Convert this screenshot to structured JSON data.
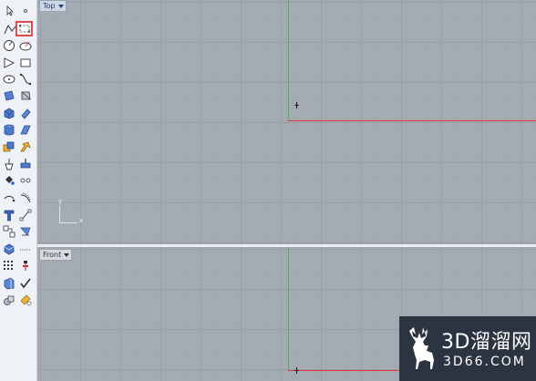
{
  "viewports": {
    "top": {
      "label": "Top"
    },
    "front": {
      "label": "Front"
    }
  },
  "gizmo": {
    "y_label": "y",
    "x_label": "x"
  },
  "watermark": {
    "title": "3D溜溜网",
    "url": "3D66.COM"
  },
  "colors": {
    "viewport_bg": "#a3aab2",
    "x_axis": "#d93b3b",
    "y_axis": "#54b060",
    "highlight": "#e24a4a",
    "watermark_bg": "#2b3440"
  },
  "toolbar": {
    "tools": [
      "select-arrow-icon",
      "point-icon",
      "polyline-icon",
      "rectangle-icon",
      "circle-icon",
      "arc-icon",
      "polygon-icon",
      "rectangle-center-icon",
      "ellipse-icon",
      "curve-icon",
      "surface-corner-icon",
      "revolve-icon",
      "box-icon",
      "cylinder-icon",
      "extrude-icon",
      "sweep-icon",
      "boolean-icon",
      "fillet-icon",
      "split-icon",
      "trim-icon",
      "paint-bucket-icon",
      "light-icon",
      "rotate-icon",
      "blend-curve-icon",
      "text-icon",
      "dimension-icon",
      "group-icon",
      "layer-icon",
      "mesh-icon",
      "grid-icon",
      "array-icon",
      "gumball-icon",
      "render-icon",
      "check-icon",
      "surface-tools-icon",
      "material-icon"
    ]
  }
}
